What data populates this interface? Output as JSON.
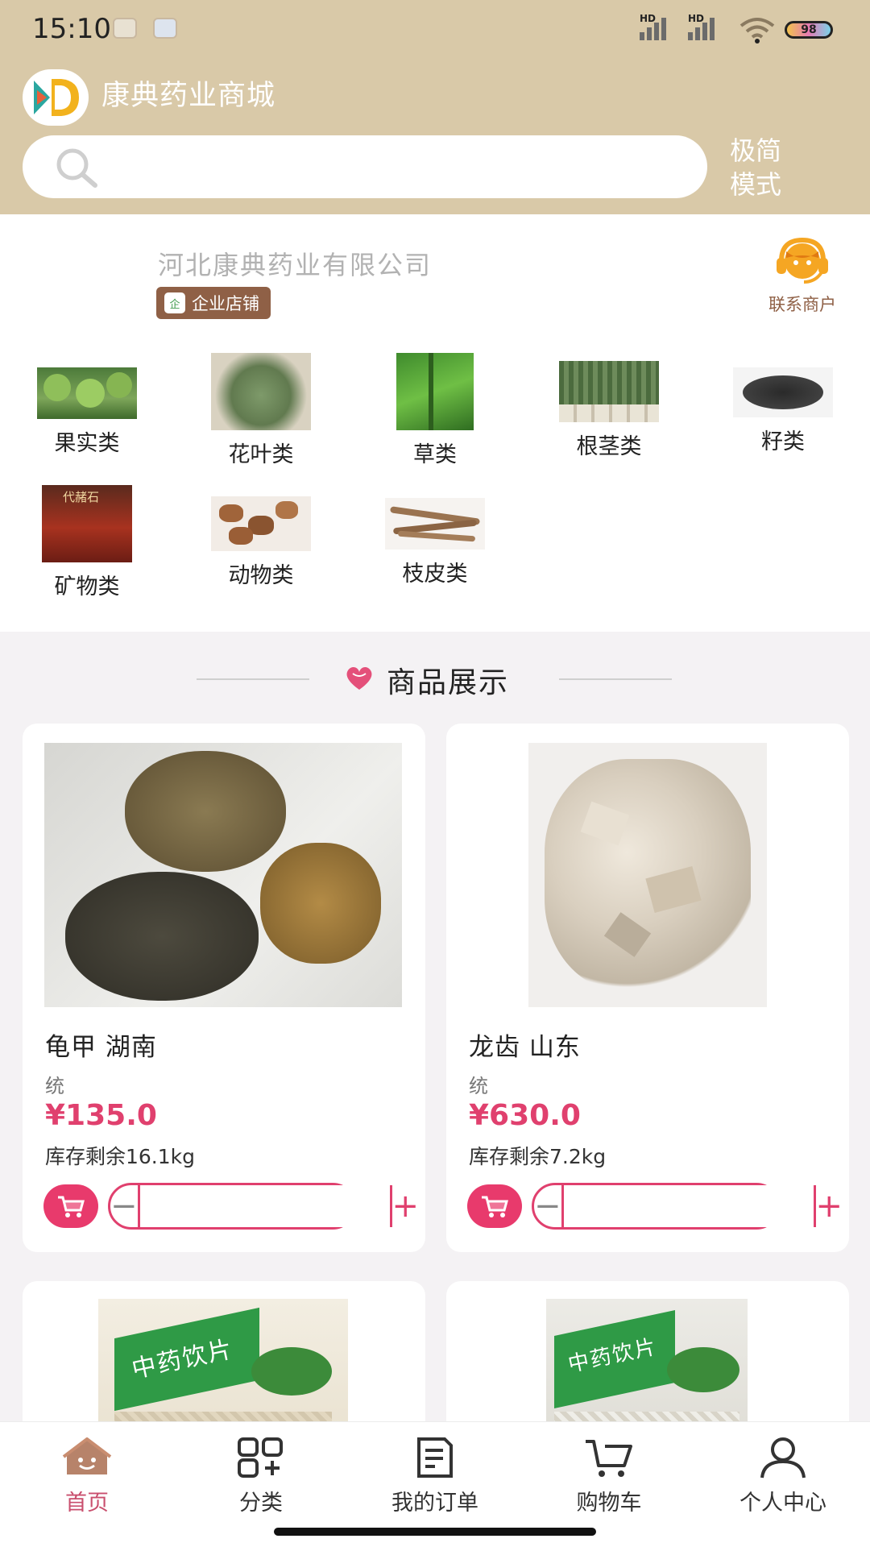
{
  "status_bar": {
    "time": "15:10",
    "battery": "98",
    "signal_label": "HD"
  },
  "header": {
    "store_name": "康典药业商城",
    "search": {
      "placeholder": "",
      "value": ""
    },
    "simple_mode_label": "极简模式"
  },
  "company": {
    "name": "河北康典药业有限公司",
    "badge_label": "企业店铺",
    "badge_icon_text": "企",
    "contact_label": "联系商户"
  },
  "categories": [
    {
      "label": "果实类",
      "icon": "fruit-image"
    },
    {
      "label": "花叶类",
      "icon": "leaf-image"
    },
    {
      "label": "草类",
      "icon": "grass-image"
    },
    {
      "label": "根茎类",
      "icon": "root-image"
    },
    {
      "label": "籽类",
      "icon": "seed-image"
    },
    {
      "label": "矿物类",
      "icon": "mineral-image",
      "image_text": "代赭石"
    },
    {
      "label": "动物类",
      "icon": "animal-image"
    },
    {
      "label": "枝皮类",
      "icon": "bark-image"
    }
  ],
  "section": {
    "title": "商品展示"
  },
  "products": [
    {
      "name": "龟甲 湖南",
      "unit": "统",
      "price": "¥135.0",
      "stock": "库存剩余16.1kg",
      "quantity": ""
    },
    {
      "name": "龙齿 山东",
      "unit": "统",
      "price": "¥630.0",
      "stock": "库存剩余7.2kg",
      "quantity": ""
    },
    {
      "name": "",
      "package_text": "中药饮片"
    },
    {
      "name": "",
      "package_text": "中药饮片"
    }
  ],
  "tabbar": [
    {
      "label": "首页",
      "icon": "home-icon",
      "active": true
    },
    {
      "label": "分类",
      "icon": "grid-icon",
      "active": false
    },
    {
      "label": "我的订单",
      "icon": "orders-icon",
      "active": false
    },
    {
      "label": "购物车",
      "icon": "cart-icon",
      "active": false
    },
    {
      "label": "个人中心",
      "icon": "user-icon",
      "active": false
    }
  ],
  "colors": {
    "header_bg": "#d9c9a8",
    "accent": "#e0406e",
    "badge": "#8f6046"
  }
}
